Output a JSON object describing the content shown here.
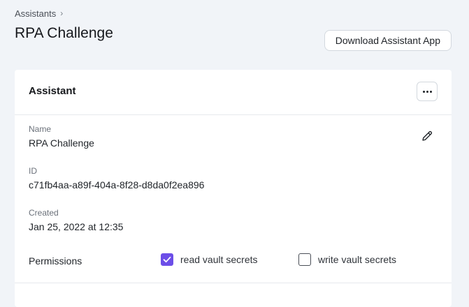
{
  "breadcrumb": {
    "items": [
      {
        "label": "Assistants"
      }
    ],
    "separator_icon": "chevron-right-icon"
  },
  "page": {
    "title": "RPA Challenge"
  },
  "header": {
    "download_button_label": "Download Assistant App"
  },
  "card": {
    "title": "Assistant",
    "more_icon": "more-horizontal-icon",
    "edit_icon": "pencil-icon",
    "fields": {
      "name": {
        "label": "Name",
        "value": "RPA Challenge"
      },
      "id": {
        "label": "ID",
        "value": "c71fb4aa-a89f-404a-8f28-d8da0f2ea896"
      },
      "created": {
        "label": "Created",
        "value": "Jan 25, 2022 at 12:35"
      }
    },
    "permissions": {
      "label": "Permissions",
      "options": [
        {
          "label": "read vault secrets",
          "checked": true
        },
        {
          "label": "write vault secrets",
          "checked": false
        }
      ]
    }
  },
  "colors": {
    "background": "#f1f4f8",
    "card": "#ffffff",
    "accent": "#6c4ee8",
    "border": "#d3d8de"
  }
}
